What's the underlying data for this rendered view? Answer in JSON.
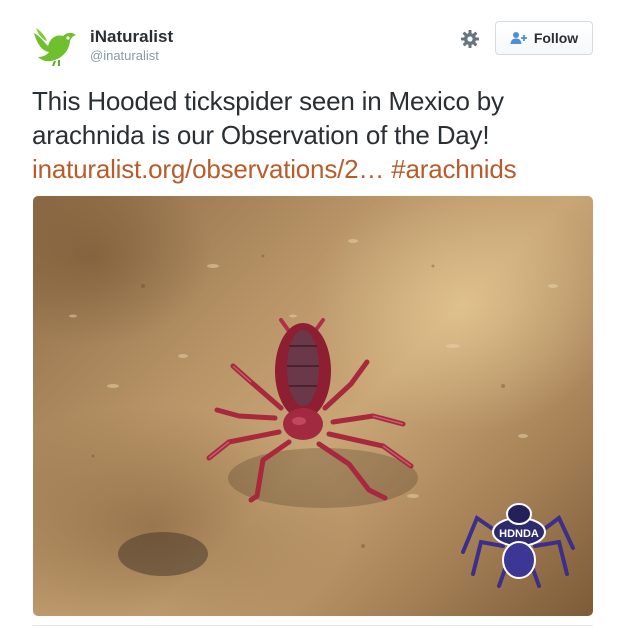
{
  "header": {
    "display_name": "iNaturalist",
    "screen_name": "@inaturalist",
    "avatar_icon": "green-bird-logo",
    "settings_icon": "gear-icon",
    "follow_icon": "person-plus-icon",
    "follow_label": "Follow"
  },
  "tweet": {
    "text": "This Hooded tickspider seen in Mexico by arachnida is our Observation of the Day!",
    "link": "inaturalist.org/observations/2…",
    "hashtag": "#arachnids",
    "link_color": "#b95c2b"
  },
  "media": {
    "photo_subject": "hooded-tickspider-photo",
    "watermark_icon": "tarantula-watermark-icon",
    "watermark_text": "HDNDA"
  }
}
